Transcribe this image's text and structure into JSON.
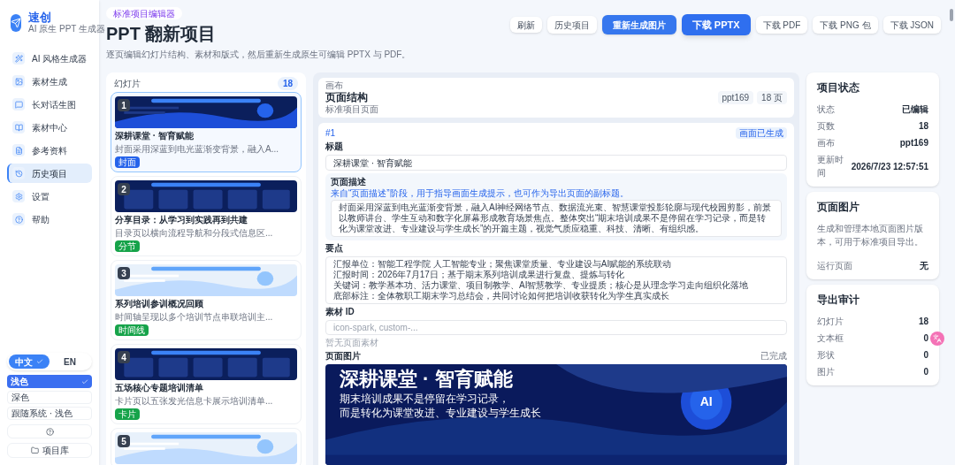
{
  "brand": {
    "name": "速创",
    "tagline": "AI 原生 PPT 生成器"
  },
  "nav": [
    {
      "label": "AI 风格生成器",
      "selected": false
    },
    {
      "label": "素材生成",
      "selected": false
    },
    {
      "label": "长对话生图",
      "selected": false
    },
    {
      "label": "素材中心",
      "selected": false
    },
    {
      "label": "参考资料",
      "selected": false
    },
    {
      "label": "历史项目",
      "selected": true
    },
    {
      "label": "设置",
      "selected": false
    },
    {
      "label": "帮助",
      "selected": false
    }
  ],
  "languages": [
    {
      "label": "中文",
      "selected": true
    },
    {
      "label": "EN",
      "selected": false
    }
  ],
  "themes": [
    {
      "label": "浅色",
      "selected": true
    },
    {
      "label": "深色",
      "selected": false
    },
    {
      "label": "跟随系统 · 浅色",
      "selected": false
    }
  ],
  "library_button": "项目库",
  "header": {
    "badge": "标准项目编辑器",
    "title": "PPT 翻新项目",
    "subtitle": "逐页编辑幻灯片结构、素材和版式，然后重新生成原生可编辑 PPTX 与 PDF。"
  },
  "toolbar": [
    {
      "label": "刷新",
      "kind": "small"
    },
    {
      "label": "历史项目",
      "kind": "plain"
    },
    {
      "label": "重新生成图片",
      "kind": "primary-small"
    },
    {
      "label": "下载 PPTX",
      "kind": "primary"
    },
    {
      "label": "下载 PDF",
      "kind": "plain"
    },
    {
      "label": "下载 PNG 包",
      "kind": "plain"
    },
    {
      "label": "下载 JSON",
      "kind": "plain"
    }
  ],
  "slides_panel": {
    "title": "幻灯片",
    "count": "18"
  },
  "slides": [
    {
      "number": "1",
      "title": "深耕课堂 · 智育赋能",
      "description": "封面采用深蓝到电光蓝渐变背景，融入A...",
      "tag": "封面",
      "color": "#2563eb",
      "selected": true
    },
    {
      "number": "2",
      "title": "分享目录：从学习到实践再到共建",
      "description": "目录页以横向流程导航和分段式信息区...",
      "tag": "分节",
      "color": "#16a34a",
      "selected": false
    },
    {
      "number": "3",
      "title": "系列培训参训概况回顾",
      "description": "时间轴呈现以多个培训节点串联培训主...",
      "tag": "时间线",
      "color": "#16a34a",
      "selected": false
    },
    {
      "number": "4",
      "title": "五场核心专题培训清单",
      "description": "卡片页以五张发光信息卡展示培训清单...",
      "tag": "卡片",
      "color": "#16a34a",
      "selected": false
    },
    {
      "number": "5"
    }
  ],
  "editor": {
    "label": "画布",
    "title": "页面结构",
    "subtitle": "标准项目页面",
    "chips": [
      "ppt169",
      "18 页"
    ],
    "page": {
      "index": "#1",
      "status": "画面已生成",
      "title_label": "标题",
      "title_value": "深耕课堂 · 智育赋能",
      "description_label": "页面描述",
      "description_hint": "来自“页面描述”阶段，用于指导画面生成提示，也可作为导出页面的副标题。",
      "description": "封面采用深蓝到电光蓝渐变背景，融入AI神经网络节点、数据流光束、智慧课堂投影轮廓与现代校园剪影，前景以教师讲台、学生互动和数字化屏幕形成教育场景焦点。整体突出“期末培训成果不是停留在学习记录，而是转化为课堂改进、专业建设与学生成长”的开篇主题，视觉气质应稳重、科技、清晰、有组织感。",
      "points_label": "要点",
      "points": [
        "汇报单位：智能工程学院 人工智能专业；聚焦课堂质量、专业建设与AI赋能的系统联动",
        "汇报时间：2026年7月17日；基于期末系列培训成果进行复盘、提炼与转化",
        "关键词：教学基本功、活力课堂、项目制教学、AI智慧教学、专业提质；核心是从理念学习走向组织化落地",
        "底部标注：全体教职工期末学习总结会，共同讨论如何把培训收获转化为学生真实成长"
      ],
      "asset_label": "素材 ID",
      "asset_placeholder": "icon-spark, custom-...",
      "asset_empty": "暂无页面素材",
      "image_label": "页面图片",
      "image_status": "已完成",
      "preview": {
        "title": "深耕课堂 · 智育赋能",
        "lines": [
          "期末培训成果不是停留在学习记录，",
          "而是转化为课堂改进、专业建设与学生成长"
        ],
        "badge": "AI"
      }
    }
  },
  "status_card": {
    "title": "项目状态",
    "rows": [
      {
        "label": "状态",
        "value": "已编辑"
      },
      {
        "label": "页数",
        "value": "18"
      },
      {
        "label": "画布",
        "value": "ppt169"
      },
      {
        "label": "更新时间",
        "value": "2026/7/23 12:57:51"
      }
    ]
  },
  "image_card": {
    "title": "页面图片",
    "text": "生成和管理本地页面图片版本，可用于标准项目导出。",
    "rows": [
      {
        "label": "运行页面",
        "value": "无"
      }
    ]
  },
  "audit_card": {
    "title": "导出审计",
    "rows": [
      {
        "label": "幻灯片",
        "value": "18"
      },
      {
        "label": "文本框",
        "value": "0"
      },
      {
        "label": "形状",
        "value": "0"
      },
      {
        "label": "图片",
        "value": "0"
      }
    ]
  }
}
